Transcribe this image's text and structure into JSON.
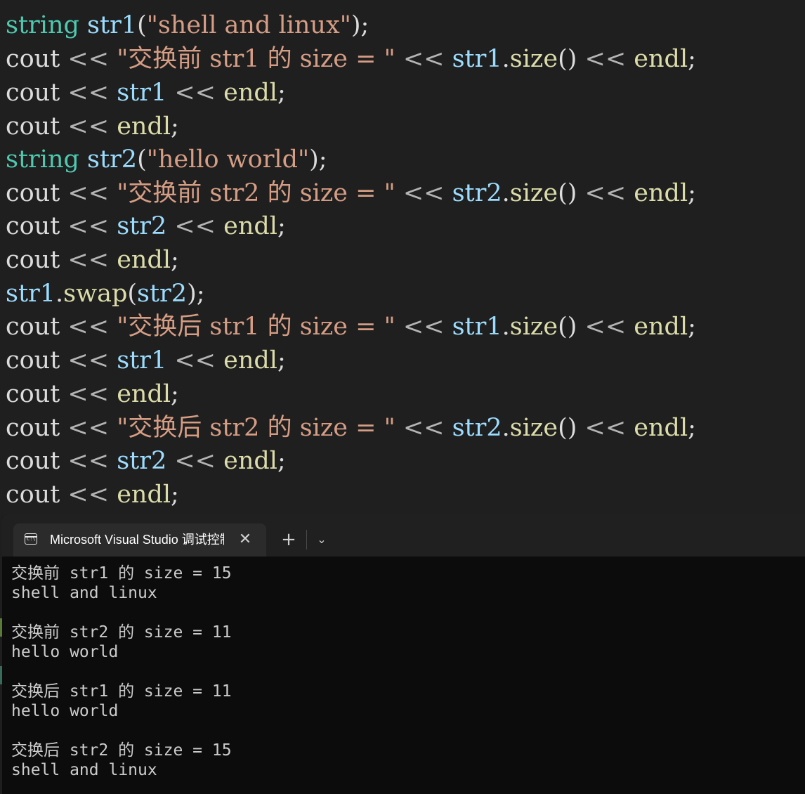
{
  "editor": {
    "lines": [
      [
        {
          "t": "string",
          "c": "tk-type"
        },
        {
          "t": " ",
          "c": "tk-plain"
        },
        {
          "t": "str1",
          "c": "tk-ident"
        },
        {
          "t": "(",
          "c": "tk-plain"
        },
        {
          "t": "\"shell and linux\"",
          "c": "tk-str"
        },
        {
          "t": ");",
          "c": "tk-plain"
        }
      ],
      [
        {
          "t": "cout",
          "c": "tk-plain"
        },
        {
          "t": " << ",
          "c": "tk-op"
        },
        {
          "t": "\"交换前 str1 的 size = \"",
          "c": "tk-str"
        },
        {
          "t": " << ",
          "c": "tk-op"
        },
        {
          "t": "str1",
          "c": "tk-ident"
        },
        {
          "t": ".",
          "c": "tk-plain"
        },
        {
          "t": "size",
          "c": "tk-func"
        },
        {
          "t": "()",
          "c": "tk-plain"
        },
        {
          "t": " << ",
          "c": "tk-op"
        },
        {
          "t": "endl",
          "c": "tk-func"
        },
        {
          "t": ";",
          "c": "tk-plain"
        }
      ],
      [
        {
          "t": "cout",
          "c": "tk-plain"
        },
        {
          "t": " << ",
          "c": "tk-op"
        },
        {
          "t": "str1",
          "c": "tk-ident"
        },
        {
          "t": " << ",
          "c": "tk-op"
        },
        {
          "t": "endl",
          "c": "tk-func"
        },
        {
          "t": ";",
          "c": "tk-plain"
        }
      ],
      [
        {
          "t": "cout",
          "c": "tk-plain"
        },
        {
          "t": " << ",
          "c": "tk-op"
        },
        {
          "t": "endl",
          "c": "tk-func"
        },
        {
          "t": ";",
          "c": "tk-plain"
        }
      ],
      [
        {
          "t": "string",
          "c": "tk-type"
        },
        {
          "t": " ",
          "c": "tk-plain"
        },
        {
          "t": "str2",
          "c": "tk-ident"
        },
        {
          "t": "(",
          "c": "tk-plain"
        },
        {
          "t": "\"hello world\"",
          "c": "tk-str"
        },
        {
          "t": ");",
          "c": "tk-plain"
        }
      ],
      [
        {
          "t": "cout",
          "c": "tk-plain"
        },
        {
          "t": " << ",
          "c": "tk-op"
        },
        {
          "t": "\"交换前 str2 的 size = \"",
          "c": "tk-str"
        },
        {
          "t": " << ",
          "c": "tk-op"
        },
        {
          "t": "str2",
          "c": "tk-ident"
        },
        {
          "t": ".",
          "c": "tk-plain"
        },
        {
          "t": "size",
          "c": "tk-func"
        },
        {
          "t": "()",
          "c": "tk-plain"
        },
        {
          "t": " << ",
          "c": "tk-op"
        },
        {
          "t": "endl",
          "c": "tk-func"
        },
        {
          "t": ";",
          "c": "tk-plain"
        }
      ],
      [
        {
          "t": "cout",
          "c": "tk-plain"
        },
        {
          "t": " << ",
          "c": "tk-op"
        },
        {
          "t": "str2",
          "c": "tk-ident"
        },
        {
          "t": " << ",
          "c": "tk-op"
        },
        {
          "t": "endl",
          "c": "tk-func"
        },
        {
          "t": ";",
          "c": "tk-plain"
        }
      ],
      [
        {
          "t": "cout",
          "c": "tk-plain"
        },
        {
          "t": " << ",
          "c": "tk-op"
        },
        {
          "t": "endl",
          "c": "tk-func"
        },
        {
          "t": ";",
          "c": "tk-plain"
        }
      ],
      [
        {
          "t": "str1",
          "c": "tk-ident"
        },
        {
          "t": ".",
          "c": "tk-plain"
        },
        {
          "t": "swap",
          "c": "tk-func"
        },
        {
          "t": "(",
          "c": "tk-plain"
        },
        {
          "t": "str2",
          "c": "tk-ident"
        },
        {
          "t": ");",
          "c": "tk-plain"
        }
      ],
      [
        {
          "t": "cout",
          "c": "tk-plain"
        },
        {
          "t": " << ",
          "c": "tk-op"
        },
        {
          "t": "\"交换后 str1 的 size = \"",
          "c": "tk-str"
        },
        {
          "t": " << ",
          "c": "tk-op"
        },
        {
          "t": "str1",
          "c": "tk-ident"
        },
        {
          "t": ".",
          "c": "tk-plain"
        },
        {
          "t": "size",
          "c": "tk-func"
        },
        {
          "t": "()",
          "c": "tk-plain"
        },
        {
          "t": " << ",
          "c": "tk-op"
        },
        {
          "t": "endl",
          "c": "tk-func"
        },
        {
          "t": ";",
          "c": "tk-plain"
        }
      ],
      [
        {
          "t": "cout",
          "c": "tk-plain"
        },
        {
          "t": " << ",
          "c": "tk-op"
        },
        {
          "t": "str1",
          "c": "tk-ident"
        },
        {
          "t": " << ",
          "c": "tk-op"
        },
        {
          "t": "endl",
          "c": "tk-func"
        },
        {
          "t": ";",
          "c": "tk-plain"
        }
      ],
      [
        {
          "t": "cout",
          "c": "tk-plain"
        },
        {
          "t": " << ",
          "c": "tk-op"
        },
        {
          "t": "endl",
          "c": "tk-func"
        },
        {
          "t": ";",
          "c": "tk-plain"
        }
      ],
      [
        {
          "t": "cout",
          "c": "tk-plain"
        },
        {
          "t": " << ",
          "c": "tk-op"
        },
        {
          "t": "\"交换后 str2 的 size = \"",
          "c": "tk-str"
        },
        {
          "t": " << ",
          "c": "tk-op"
        },
        {
          "t": "str2",
          "c": "tk-ident"
        },
        {
          "t": ".",
          "c": "tk-plain"
        },
        {
          "t": "size",
          "c": "tk-func"
        },
        {
          "t": "()",
          "c": "tk-plain"
        },
        {
          "t": " << ",
          "c": "tk-op"
        },
        {
          "t": "endl",
          "c": "tk-func"
        },
        {
          "t": ";",
          "c": "tk-plain"
        }
      ],
      [
        {
          "t": "cout",
          "c": "tk-plain"
        },
        {
          "t": " << ",
          "c": "tk-op"
        },
        {
          "t": "str2",
          "c": "tk-ident"
        },
        {
          "t": " << ",
          "c": "tk-op"
        },
        {
          "t": "endl",
          "c": "tk-func"
        },
        {
          "t": ";",
          "c": "tk-plain"
        }
      ],
      [
        {
          "t": "cout",
          "c": "tk-plain"
        },
        {
          "t": " << ",
          "c": "tk-op"
        },
        {
          "t": "endl",
          "c": "tk-func"
        },
        {
          "t": ";",
          "c": "tk-plain"
        }
      ]
    ]
  },
  "console": {
    "tab": {
      "icon": "console-icon",
      "icon_text": "C:\\",
      "title": "Microsoft Visual Studio 调试控制台",
      "close_symbol": "✕"
    },
    "new_tab_symbol": "+",
    "dropdown_symbol": "⌄",
    "output_lines": [
      "交换前 str1 的 size = 15",
      "shell and linux",
      "",
      "交换前 str2 的 size = 11",
      "hello world",
      "",
      "交换后 str1 的 size = 11",
      "hello world",
      "",
      "交换后 str2 的 size = 15",
      "shell and linux"
    ]
  },
  "colors": {
    "editor_bg": "#1f1f1f",
    "console_bg": "#0c0c0c",
    "type": "#4ec9b0",
    "identifier": "#9cdcfe",
    "string": "#d69d85",
    "function": "#dcdcaa",
    "plain": "#dcdcdc"
  }
}
